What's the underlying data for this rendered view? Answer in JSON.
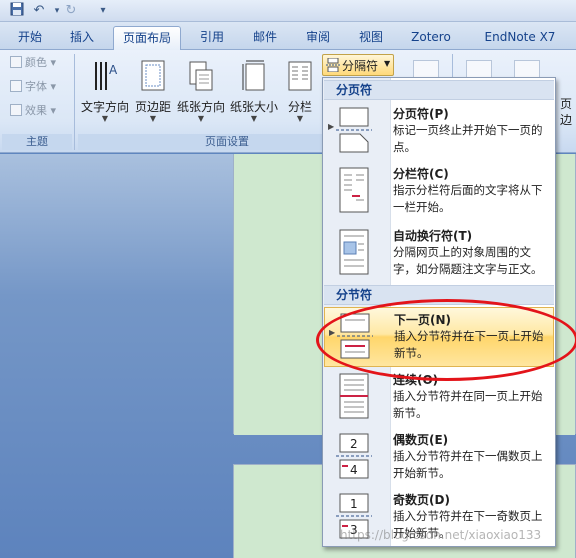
{
  "qat": {
    "buttons": [
      "save-icon",
      "undo-icon",
      "redo-icon",
      "customize-icon"
    ]
  },
  "tabs": [
    {
      "label": "开始"
    },
    {
      "label": "插入"
    },
    {
      "label": "页面布局",
      "active": true
    },
    {
      "label": "引用"
    },
    {
      "label": "邮件"
    },
    {
      "label": "审阅"
    },
    {
      "label": "视图"
    },
    {
      "label": "Zotero"
    },
    {
      "label": "EndNote X7"
    }
  ],
  "ribbon": {
    "themes": {
      "items": [
        "颜色",
        "字体",
        "效果"
      ],
      "group_label": "主题"
    },
    "page_setup": {
      "group_label": "页面设置",
      "buttons": [
        "文字方向",
        "页边距",
        "纸张方向",
        "纸张大小",
        "分栏"
      ],
      "breaks_button": "分隔符"
    },
    "right_edge": [
      "页",
      "边"
    ]
  },
  "menu": {
    "section1_header": "分页符",
    "section2_header": "分节符",
    "items": [
      {
        "title": "分页符(P)",
        "desc": "标记一页终止并开始下一页的点。"
      },
      {
        "title": "分栏符(C)",
        "desc": "指示分栏符后面的文字将从下一栏开始。"
      },
      {
        "title": "自动换行符(T)",
        "desc": "分隔网页上的对象周围的文字，如分隔题注文字与正文。"
      },
      {
        "title": "下一页(N)",
        "desc": "插入分节符并在下一页上开始新节。",
        "highlighted": true
      },
      {
        "title": "连续(O)",
        "desc": "插入分节符并在同一页上开始新节。"
      },
      {
        "title": "偶数页(E)",
        "desc": "插入分节符并在下一偶数页上开始新节。",
        "page_number": "2"
      },
      {
        "title": "奇数页(D)",
        "desc": "插入分节符并在下一奇数页上开始新节。",
        "page_number": "1"
      }
    ]
  },
  "watermark": "https://blog.csdn.net/xiaoxiao133",
  "colors": {
    "highlight": "#ffd66b",
    "annotation_ellipse": "#e3141a",
    "tab_text": "#15428b"
  }
}
